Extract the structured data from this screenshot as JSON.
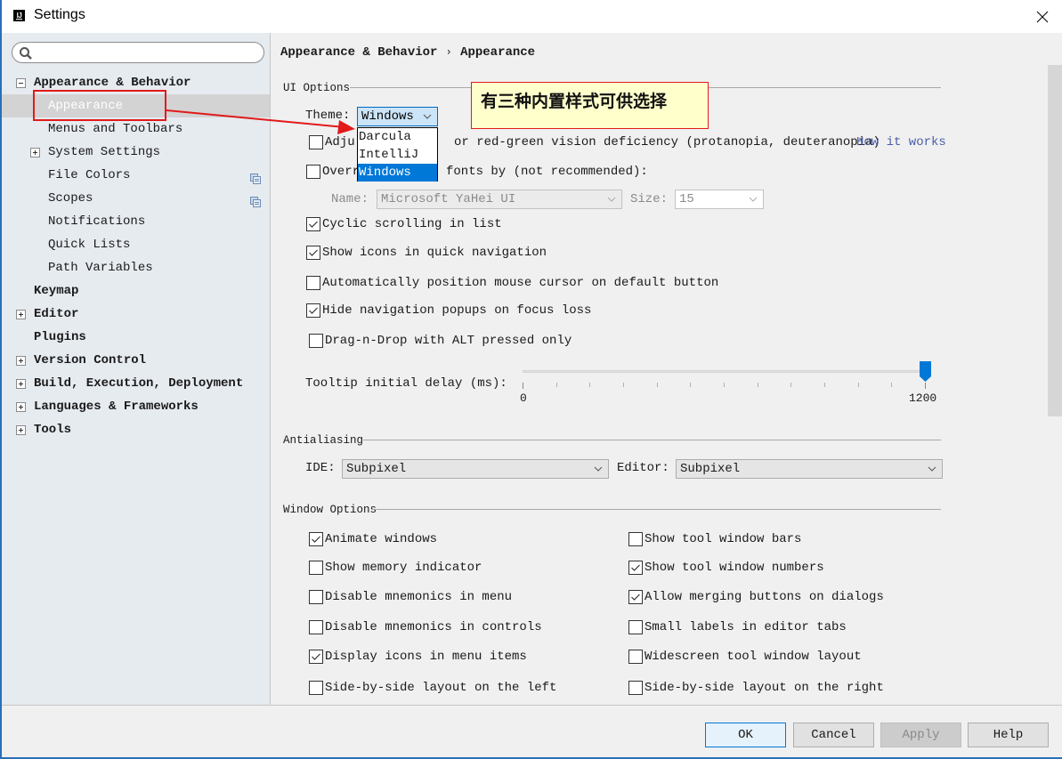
{
  "window": {
    "title": "Settings",
    "app_icon_text": "IJ"
  },
  "sidebar": {
    "search": {
      "value": "",
      "placeholder": ""
    },
    "items": [
      {
        "label": "Appearance & Behavior",
        "level": 0,
        "bold": true,
        "expander": "minus"
      },
      {
        "label": "Appearance",
        "level": 1,
        "bold": false,
        "selected": true
      },
      {
        "label": "Menus and Toolbars",
        "level": 1,
        "bold": false
      },
      {
        "label": "System Settings",
        "level": 1,
        "bold": false,
        "expander": "plus"
      },
      {
        "label": "File Colors",
        "level": 1,
        "bold": false,
        "badge": "project-settings-icon"
      },
      {
        "label": "Scopes",
        "level": 1,
        "bold": false,
        "badge": "project-settings-icon"
      },
      {
        "label": "Notifications",
        "level": 1,
        "bold": false
      },
      {
        "label": "Quick Lists",
        "level": 1,
        "bold": false
      },
      {
        "label": "Path Variables",
        "level": 1,
        "bold": false
      },
      {
        "label": "Keymap",
        "level": 0,
        "bold": true
      },
      {
        "label": "Editor",
        "level": 0,
        "bold": true,
        "expander": "plus"
      },
      {
        "label": "Plugins",
        "level": 0,
        "bold": true
      },
      {
        "label": "Version Control",
        "level": 0,
        "bold": true,
        "expander": "plus"
      },
      {
        "label": "Build, Execution, Deployment",
        "level": 0,
        "bold": true,
        "expander": "plus"
      },
      {
        "label": "Languages & Frameworks",
        "level": 0,
        "bold": true,
        "expander": "plus"
      },
      {
        "label": "Tools",
        "level": 0,
        "bold": true,
        "expander": "plus"
      }
    ]
  },
  "breadcrumb": {
    "parent": "Appearance & Behavior",
    "separator": "›",
    "current": "Appearance"
  },
  "ui_options": {
    "section_title": "UI Options",
    "theme": {
      "label": "Theme:",
      "value": "Windows",
      "options": [
        "Darcula",
        "IntelliJ",
        "Windows"
      ],
      "selected_index": 2,
      "open": true
    },
    "adjust_colors": {
      "label": "Adjust colors for red-green vision deficiency (protanopia, deuteranopia)",
      "visible_suffix": "or red-green vision deficiency (protanopia, deuteranopia)",
      "visible_prefix": "Adju",
      "checked": false,
      "link": "How it works"
    },
    "override_fonts": {
      "label": "Override default fonts by (not recommended):",
      "visible_prefix": "Overr",
      "visible_suffix": "fonts by (not recommended):",
      "checked": false
    },
    "font_name": {
      "label": "Name:",
      "value": "Microsoft YaHei UI",
      "enabled": false
    },
    "font_size": {
      "label": "Size:",
      "value": "15",
      "enabled": false
    },
    "checkboxes": [
      {
        "label": "Cyclic scrolling in list",
        "checked": true
      },
      {
        "label": "Show icons in quick navigation",
        "checked": true
      },
      {
        "label": "Automatically position mouse cursor on default button",
        "checked": false
      },
      {
        "label": "Hide navigation popups on focus loss",
        "checked": true
      },
      {
        "label": "Drag-n-Drop with ALT pressed only",
        "checked": false
      }
    ],
    "tooltip_delay": {
      "label": "Tooltip initial delay (ms):",
      "min": 0,
      "max": 1200,
      "value": 1200,
      "tick_step": 100,
      "min_label": "0",
      "max_label": "1200"
    }
  },
  "antialiasing": {
    "section_title": "Antialiasing",
    "ide": {
      "label": "IDE:",
      "value": "Subpixel"
    },
    "editor": {
      "label": "Editor:",
      "value": "Subpixel"
    }
  },
  "window_options": {
    "section_title": "Window Options",
    "left": [
      {
        "label": "Animate windows",
        "checked": true
      },
      {
        "label": "Show memory indicator",
        "checked": false
      },
      {
        "label": "Disable mnemonics in menu",
        "checked": false
      },
      {
        "label": "Disable mnemonics in controls",
        "checked": false
      },
      {
        "label": "Display icons in menu items",
        "checked": true
      },
      {
        "label": "Side-by-side layout on the left",
        "checked": false
      }
    ],
    "right": [
      {
        "label": "Show tool window bars",
        "checked": false
      },
      {
        "label": "Show tool window numbers",
        "checked": true
      },
      {
        "label": "Allow merging buttons on dialogs",
        "checked": true
      },
      {
        "label": "Small labels in editor tabs",
        "checked": false
      },
      {
        "label": "Widescreen tool window layout",
        "checked": false
      },
      {
        "label": "Side-by-side layout on the right",
        "checked": false
      }
    ]
  },
  "footer": {
    "ok": "OK",
    "cancel": "Cancel",
    "apply": "Apply",
    "help": "Help"
  },
  "annotation": {
    "callout_text": "有三种内置样式可供选择",
    "color": "#e21a1a"
  },
  "colors": {
    "accent": "#0078d7",
    "sidebar_bg": "#e6ebf0",
    "selection_bg": "#d3d3d3",
    "link": "#4a5da8",
    "callout_bg": "#ffffcc"
  }
}
